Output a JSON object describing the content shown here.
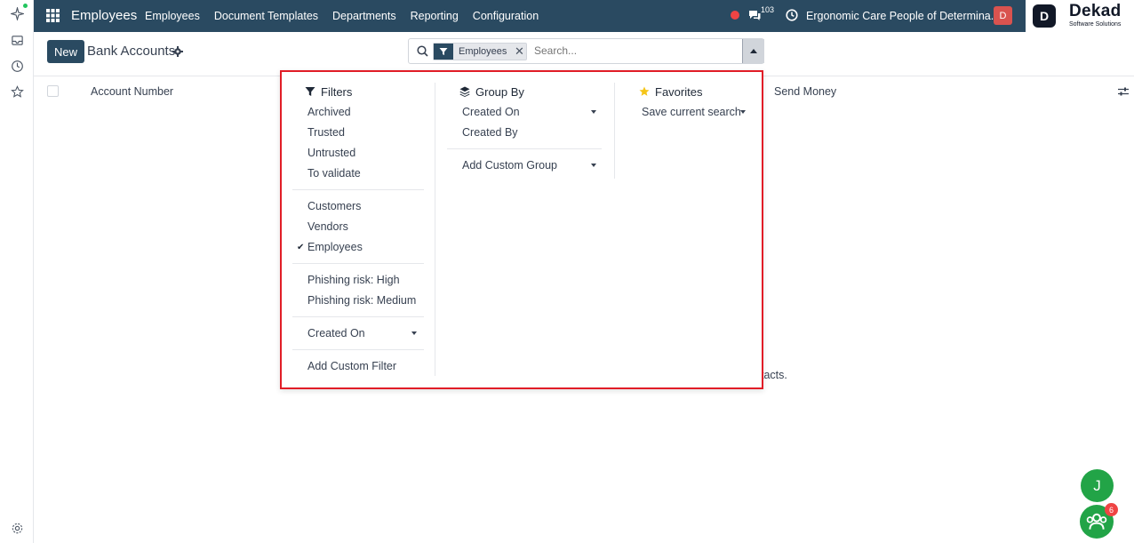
{
  "topbar": {
    "app_title": "Employees",
    "nav": [
      "Employees",
      "Document Templates",
      "Departments",
      "Reporting",
      "Configuration"
    ],
    "messages_count": "103",
    "company": "Ergonomic Care People of Determina...",
    "avatar_letter": "D",
    "brand_letter": "D",
    "brand_name": "Dekad",
    "brand_tagline": "Software Solutions"
  },
  "control": {
    "new_label": "New",
    "breadcrumb": "Bank Accounts",
    "facet_label": "Employees",
    "facet_remove": "✕",
    "search_placeholder": "Search..."
  },
  "list": {
    "columns": [
      "Account Number",
      "Send Money"
    ],
    "empty_fragment": "tacts."
  },
  "filters": {
    "title": "Filters",
    "group1": [
      "Archived",
      "Trusted",
      "Untrusted",
      "To validate"
    ],
    "group2": [
      "Customers",
      "Vendors",
      "Employees"
    ],
    "checked": "Employees",
    "group3": [
      "Phishing risk: High",
      "Phishing risk: Medium"
    ],
    "created_on": "Created On",
    "add_custom": "Add Custom Filter"
  },
  "groupby": {
    "title": "Group By",
    "items": [
      "Created On",
      "Created By"
    ],
    "add_custom": "Add Custom Group"
  },
  "favorites": {
    "title": "Favorites",
    "save": "Save current search"
  },
  "bubbles": {
    "user_letter": "J",
    "group_badge": "6"
  },
  "colors": {
    "topbar": "#2a4a61",
    "highlight_border": "#e11d27",
    "favorites_star": "#f5c518",
    "bubble": "#22a447"
  }
}
